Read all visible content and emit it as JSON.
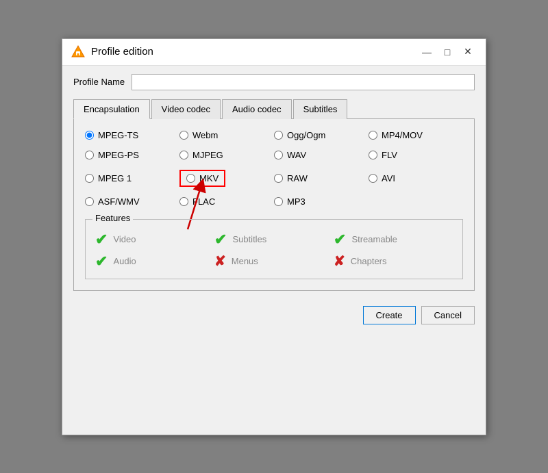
{
  "window": {
    "title": "Profile edition",
    "vlc_icon_color": "#f90"
  },
  "title_controls": {
    "minimize": "—",
    "maximize": "□",
    "close": "✕"
  },
  "profile_name": {
    "label": "Profile Name",
    "placeholder": ""
  },
  "tabs": [
    {
      "label": "Encapsulation",
      "active": true
    },
    {
      "label": "Video codec",
      "active": false
    },
    {
      "label": "Audio codec",
      "active": false
    },
    {
      "label": "Subtitles",
      "active": false
    }
  ],
  "radio_options": [
    {
      "col": 0,
      "row": 0,
      "label": "MPEG-TS",
      "checked": true,
      "highlighted": false
    },
    {
      "col": 1,
      "row": 0,
      "label": "Webm",
      "checked": false,
      "highlighted": false
    },
    {
      "col": 2,
      "row": 0,
      "label": "Ogg/Ogm",
      "checked": false,
      "highlighted": false
    },
    {
      "col": 3,
      "row": 0,
      "label": "MP4/MOV",
      "checked": false,
      "highlighted": false
    },
    {
      "col": 0,
      "row": 1,
      "label": "MPEG-PS",
      "checked": false,
      "highlighted": false
    },
    {
      "col": 1,
      "row": 1,
      "label": "MJPEG",
      "checked": false,
      "highlighted": false
    },
    {
      "col": 2,
      "row": 1,
      "label": "WAV",
      "checked": false,
      "highlighted": false
    },
    {
      "col": 3,
      "row": 1,
      "label": "FLV",
      "checked": false,
      "highlighted": false
    },
    {
      "col": 0,
      "row": 2,
      "label": "MPEG 1",
      "checked": false,
      "highlighted": false
    },
    {
      "col": 1,
      "row": 2,
      "label": "MKV",
      "checked": false,
      "highlighted": true
    },
    {
      "col": 2,
      "row": 2,
      "label": "RAW",
      "checked": false,
      "highlighted": false
    },
    {
      "col": 3,
      "row": 2,
      "label": "AVI",
      "checked": false,
      "highlighted": false
    },
    {
      "col": 0,
      "row": 3,
      "label": "ASF/WMV",
      "checked": false,
      "highlighted": false
    },
    {
      "col": 1,
      "row": 3,
      "label": "FLAC",
      "checked": false,
      "highlighted": false
    },
    {
      "col": 2,
      "row": 3,
      "label": "MP3",
      "checked": false,
      "highlighted": false
    }
  ],
  "features": {
    "legend": "Features",
    "items": [
      {
        "label": "Video",
        "type": "check",
        "row": 0,
        "col": 0
      },
      {
        "label": "Subtitles",
        "type": "check",
        "row": 0,
        "col": 1
      },
      {
        "label": "Streamable",
        "type": "check",
        "row": 0,
        "col": 2
      },
      {
        "label": "Audio",
        "type": "check",
        "row": 1,
        "col": 0
      },
      {
        "label": "Menus",
        "type": "cross",
        "row": 1,
        "col": 1
      },
      {
        "label": "Chapters",
        "type": "cross",
        "row": 1,
        "col": 2
      }
    ]
  },
  "footer": {
    "create_label": "Create",
    "cancel_label": "Cancel"
  }
}
